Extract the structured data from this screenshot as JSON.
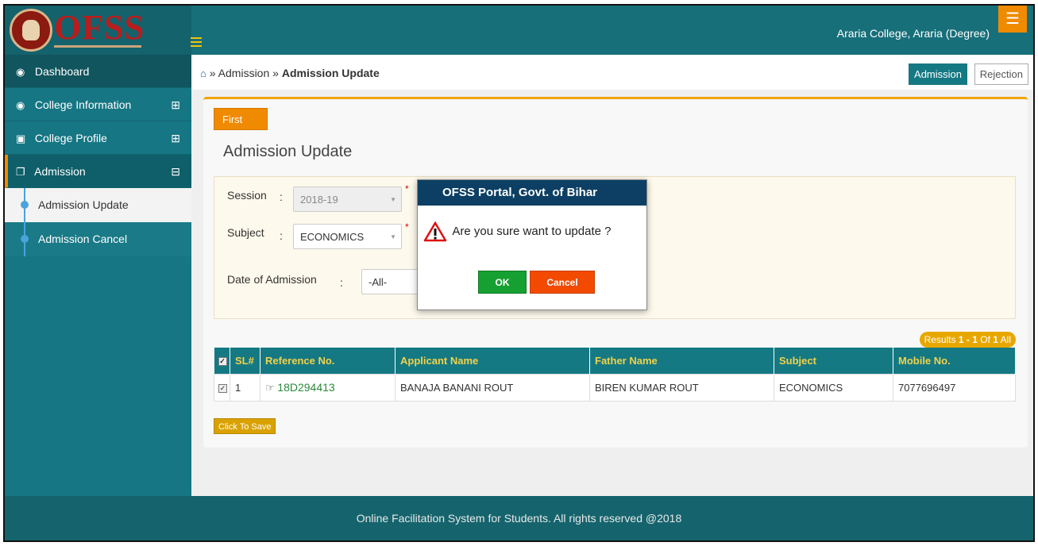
{
  "header": {
    "logo_text": "OFSS",
    "college_name": "Araria College, Araria (Degree)",
    "menu_icon": "list-icon"
  },
  "sidebar": {
    "items": [
      {
        "label": "Dashboard",
        "icon": "dashboard-icon"
      },
      {
        "label": "College Information",
        "icon": "dashboard-icon",
        "toggle": "⊞"
      },
      {
        "label": "College Profile",
        "icon": "id-card-icon",
        "toggle": "⊞"
      },
      {
        "label": "Admission",
        "icon": "copy-icon",
        "toggle": "⊟"
      }
    ],
    "sub_items": [
      {
        "label": "Admission Update"
      },
      {
        "label": "Admission Cancel"
      }
    ]
  },
  "breadcrumb": {
    "sep1": "»",
    "level1": "Admission",
    "sep2": "»",
    "current": "Admission Update"
  },
  "tabs": {
    "admission": "Admission",
    "rejection": "Rejection"
  },
  "panel": {
    "first_button": "First",
    "title": "Admission Update"
  },
  "filters": {
    "session_label": "Session",
    "session_value": "2018-19",
    "subject_label": "Subject",
    "subject_value": "ECONOMICS",
    "date_label": "Date of Admission",
    "date_value": "-All-",
    "colon": ":",
    "required_mark": "*"
  },
  "results": {
    "prefix": "Results",
    "range": "1 - 1",
    "of_label": "Of",
    "total": "1",
    "all_label": "All"
  },
  "table": {
    "headers": [
      "SL#",
      "Reference No.",
      "Applicant Name",
      "Father Name",
      "Subject",
      "Mobile No."
    ],
    "rows": [
      {
        "sl": "1",
        "reference": "18D294413",
        "applicant": "BANAJA BANANI ROUT",
        "father": "BIREN KUMAR ROUT",
        "subject": "ECONOMICS",
        "mobile": "7077696497"
      }
    ]
  },
  "save_button": "Click To Save",
  "footer": {
    "text": "Online Facilitation System for Students. All rights reserved @2018"
  },
  "modal": {
    "title": "OFSS Portal, Govt. of Bihar",
    "message": "Are you sure want to update ?",
    "ok_label": "OK",
    "cancel_label": "Cancel"
  },
  "colors": {
    "teal": "#176f7a",
    "orange": "#f08a00",
    "modal_header": "#0c3f63",
    "ok_green": "#17a032",
    "cancel_orange": "#f24a00"
  }
}
